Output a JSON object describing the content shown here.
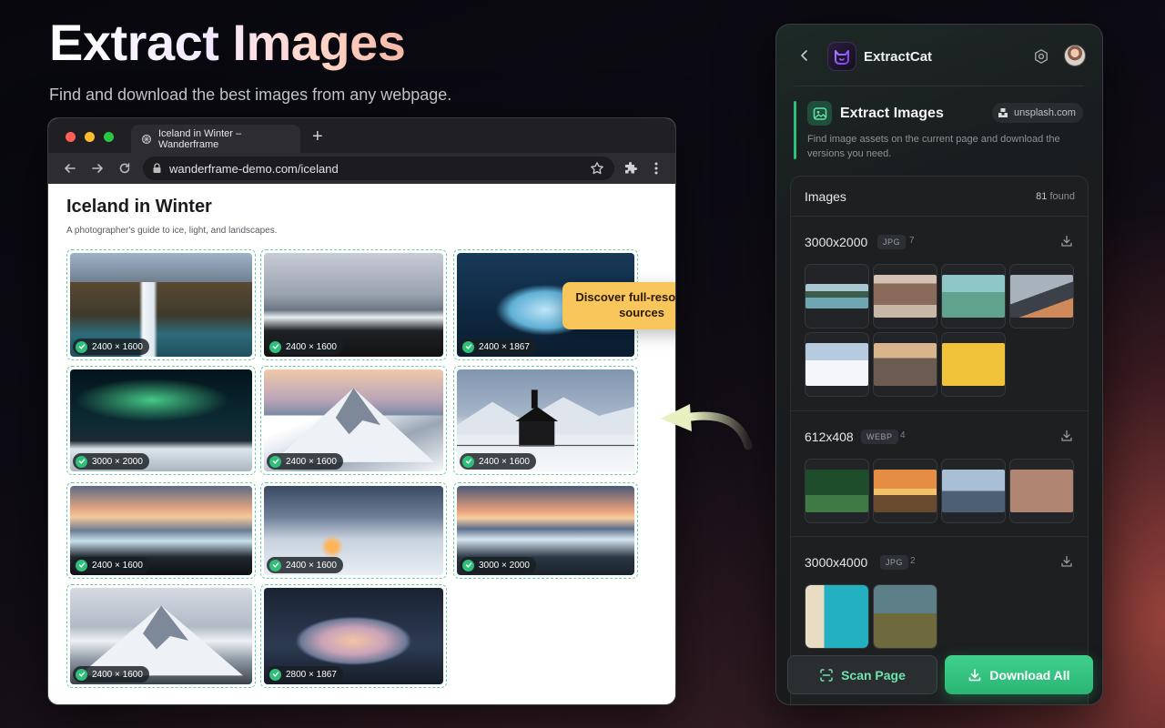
{
  "hero": {
    "title": "Extract Images",
    "subtitle": "Find and download the best images from any webpage."
  },
  "browser": {
    "tab_title": "Iceland in Winter – Wanderframe",
    "url": "wanderframe-demo.com/iceland",
    "page_title": "Iceland in Winter",
    "page_subtitle": "A photographer's guide to ice, light, and landscapes.",
    "callout": "Discover full-resolution sources",
    "images": [
      {
        "dims": "2400 × 1600",
        "scene": "waterfall"
      },
      {
        "dims": "2400 × 1600",
        "scene": "black-beach"
      },
      {
        "dims": "2400 × 1867",
        "scene": "ice-cave"
      },
      {
        "dims": "3000 × 2000",
        "scene": "aurora"
      },
      {
        "dims": "2400 × 1600",
        "scene": "mountain"
      },
      {
        "dims": "2400 × 1600",
        "scene": "black-church"
      },
      {
        "dims": "2400 × 1600",
        "scene": "ice-beach-sunset"
      },
      {
        "dims": "2400 × 1600",
        "scene": "cabin"
      },
      {
        "dims": "3000 × 2000",
        "scene": "glacier-lagoon"
      },
      {
        "dims": "2400 × 1600",
        "scene": "sea-stacks"
      },
      {
        "dims": "2800 × 1867",
        "scene": "cave-arch"
      }
    ]
  },
  "panel": {
    "brand": "ExtractCat",
    "feature_title": "Extract Images",
    "domain": "unsplash.com",
    "description": "Find image assets on the current page and download the versions you need.",
    "list_title": "Images",
    "found_count": "81",
    "found_label": "found",
    "groups": [
      {
        "size": "3000x2000",
        "format": "JPG",
        "count": "7"
      },
      {
        "size": "612x408",
        "format": "WEBP",
        "count": "4"
      },
      {
        "size": "3000x4000",
        "format": "JPG",
        "count": "2"
      }
    ],
    "scan_button": "Scan Page",
    "download_button": "Download All"
  },
  "colors": {
    "accent_green": "#2fbf7a",
    "callout_yellow": "#f8c65a",
    "dashed_border": "#6ccfa3"
  },
  "icons": [
    "back-icon",
    "cat-logo-icon",
    "gear-icon",
    "image-icon",
    "download-icon",
    "scan-icon",
    "check-icon",
    "star-icon",
    "extension-icon",
    "lock-icon"
  ]
}
